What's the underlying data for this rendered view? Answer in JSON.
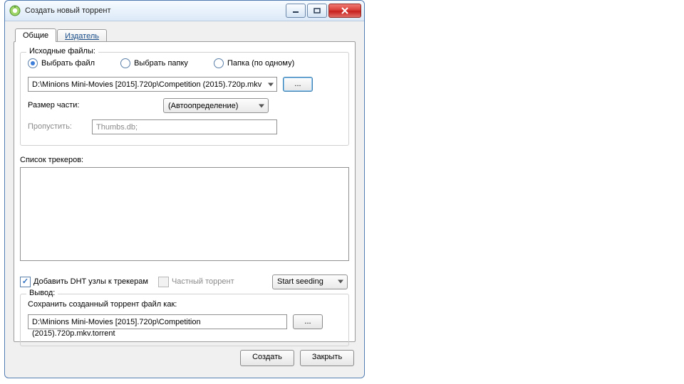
{
  "window": {
    "title": "Создать новый торрент"
  },
  "tabs": {
    "general": "Общие",
    "publisher": "Издатель"
  },
  "source": {
    "legend": "Исходные файлы:",
    "radio_file": "Выбрать файл",
    "radio_folder": "Выбрать папку",
    "radio_folder_each": "Папка (по одному)",
    "path": "D:\\Minions Mini-Movies [2015].720p\\Competition (2015).720p.mkv",
    "browse": "...",
    "piece_label": "Размер части:",
    "piece_value": "(Автоопределение)",
    "skip_label": "Пропустить:",
    "skip_value": "Thumbs.db;"
  },
  "trackers": {
    "label": "Список трекеров:",
    "value": ""
  },
  "options": {
    "dht": "Добавить DHT узлы к трекерам",
    "private": "Частный торрент",
    "seeding": "Start seeding"
  },
  "output": {
    "legend": "Вывод:",
    "save_as_label": "Сохранить созданный торрент файл как:",
    "path": "D:\\Minions Mini-Movies [2015].720p\\Competition (2015).720p.mkv.torrent",
    "browse": "..."
  },
  "buttons": {
    "create": "Создать",
    "close": "Закрыть"
  }
}
